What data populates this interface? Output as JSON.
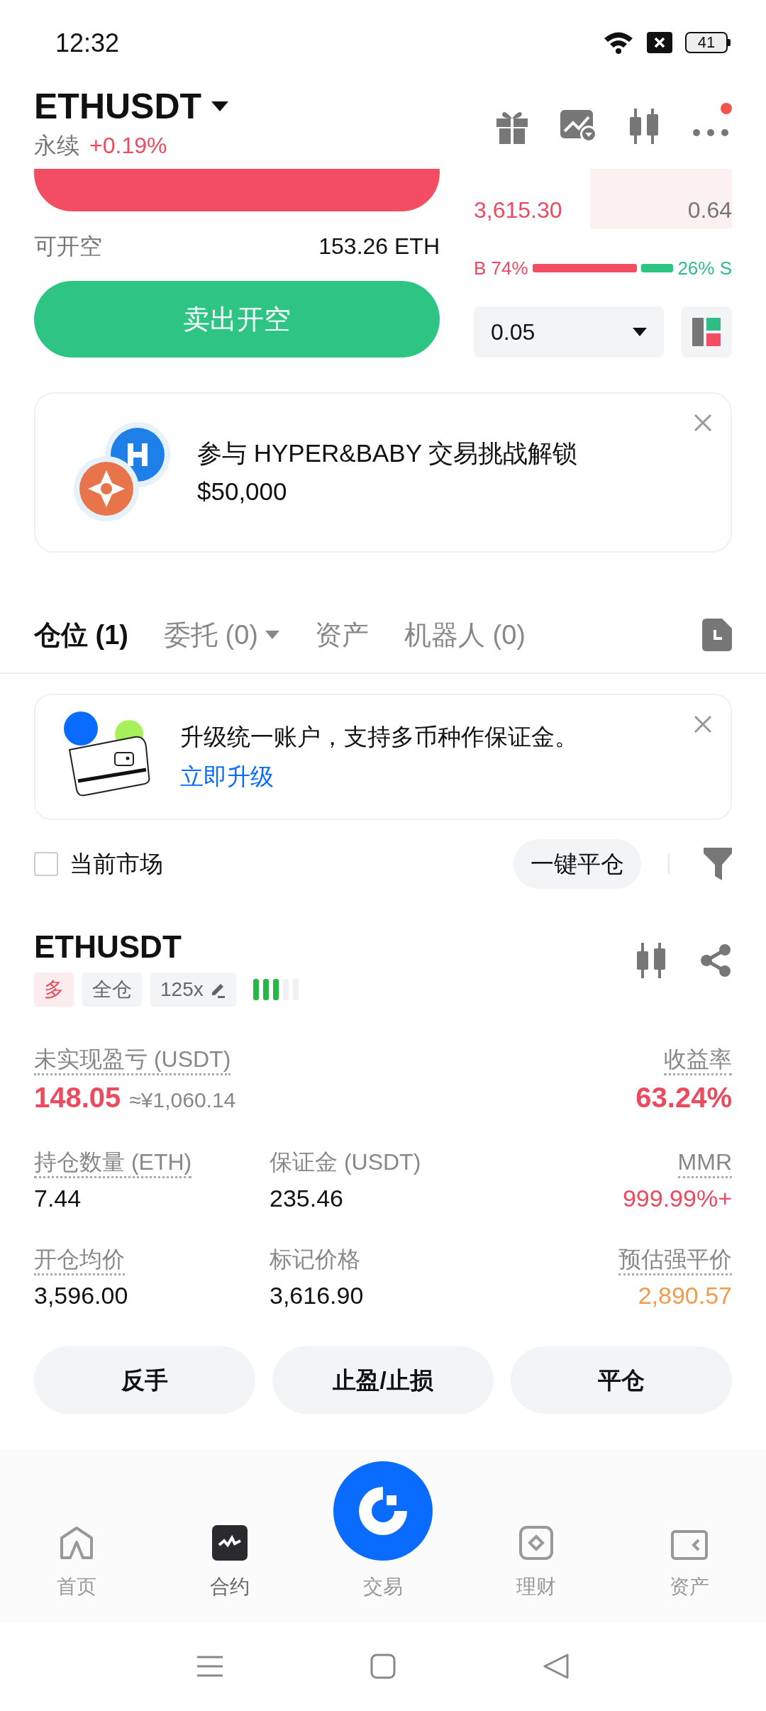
{
  "status_bar": {
    "time": "12:32",
    "battery": "41"
  },
  "header": {
    "symbol": "ETHUSDT",
    "contract": "永续",
    "change": "+0.19%",
    "has_notification": true
  },
  "trade": {
    "available_label": "可开空",
    "available_value": "153.26 ETH",
    "sell_button": "卖出开空"
  },
  "order_book": {
    "asks": [
      {
        "price": "3,615.30",
        "qty": "0.64"
      }
    ],
    "ratio": {
      "buy_label": "B 74%",
      "sell_label": "26% S",
      "level": 0.74
    },
    "step_select": "0.05"
  },
  "promo": {
    "text": "参与 HYPER&BABY 交易挑战解锁 $50,000"
  },
  "tabs": [
    {
      "label": "仓位 (1)",
      "selected": true,
      "dropdown": false
    },
    {
      "label": "委托 (0)",
      "selected": false,
      "dropdown": true
    },
    {
      "label": "资产",
      "selected": false,
      "dropdown": false
    },
    {
      "label": "机器人 (0)",
      "selected": false,
      "dropdown": false
    }
  ],
  "notice": {
    "text": "升级统一账户，支持多币种作保证金。",
    "link": "立即升级"
  },
  "filter": {
    "label": "当前市场",
    "checked": false,
    "close_all": "一键平仓"
  },
  "position": {
    "symbol": "ETHUSDT",
    "tags": [
      {
        "kind": "side",
        "label": "多"
      },
      {
        "kind": "margin",
        "label": "全仓"
      },
      {
        "kind": "leverage",
        "label": "125x"
      }
    ],
    "strength": {
      "level": 0.6
    },
    "rows": [
      {
        "kind": "primary",
        "cells": [
          {
            "label": "未实现盈亏 (USDT)",
            "hint": true,
            "value": "148.05",
            "secondary": "≈¥1,060.14",
            "color": "#ec4a5f"
          },
          {},
          {
            "label": "收益率",
            "hint": true,
            "value": "63.24%",
            "color": "#ec4a5f"
          }
        ]
      },
      {
        "kind": "regular",
        "cells": [
          {
            "label": "持仓数量 (ETH)",
            "hint": true,
            "value": "7.44"
          },
          {
            "label": "保证金 (USDT)",
            "hint": false,
            "value": "235.46"
          },
          {
            "label": "MMR",
            "hint": true,
            "value": "999.99%+",
            "color": "#ec4a5f"
          }
        ]
      },
      {
        "kind": "regular",
        "cells": [
          {
            "label": "开仓均价",
            "hint": true,
            "value": "3,596.00"
          },
          {
            "label": "标记价格",
            "hint": false,
            "value": "3,616.90"
          },
          {
            "label": "预估强平价",
            "hint": true,
            "value": "2,890.57",
            "color": "#f39a4e"
          }
        ]
      }
    ],
    "actions": [
      "反手",
      "止盈/止损",
      "平仓"
    ]
  },
  "nav": [
    {
      "kind": "home",
      "label": "首页",
      "selected": false
    },
    {
      "kind": "futures",
      "label": "合约",
      "selected": true
    },
    {
      "kind": "center",
      "label": "交易",
      "selected": false
    },
    {
      "kind": "earn",
      "label": "理财",
      "selected": false
    },
    {
      "kind": "assets",
      "label": "资产",
      "selected": false
    }
  ]
}
